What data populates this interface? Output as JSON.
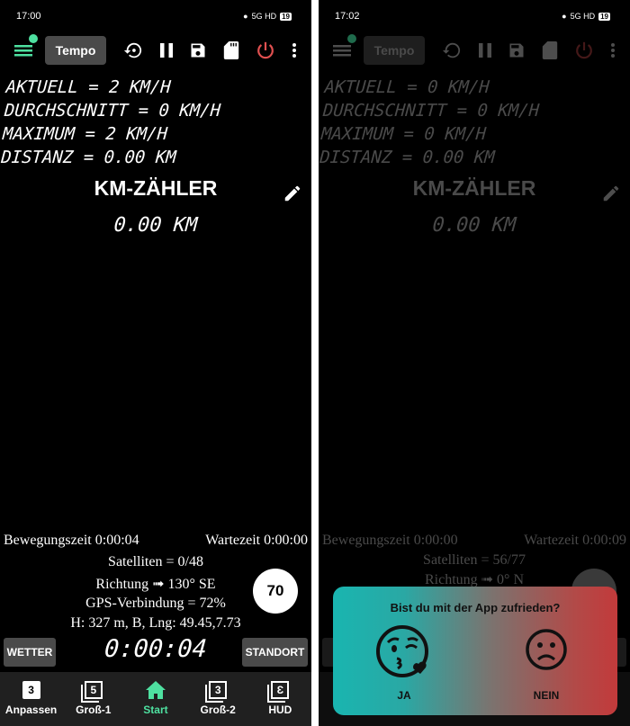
{
  "left": {
    "status": {
      "time": "17:00",
      "signal": "5G HD",
      "battery": "19"
    },
    "toolbar": {
      "tempo_label": "Tempo",
      "icons": [
        "menu-icon",
        "history-icon",
        "pause-icon",
        "save-icon",
        "sd-card-icon",
        "power-icon",
        "more-vert-icon"
      ],
      "accent": "#4ee0a0",
      "power_color": "#e05050"
    },
    "readouts": [
      "AKTUELL = 2 KM/H",
      "DURCHSCHNITT = 0 KM/H",
      "MAXIMUM = 2 KM/H",
      "DISTANZ = 0.00 KM"
    ],
    "km_title": "KM-ZÄHLER",
    "km_value": "0.00 KM",
    "moving_time": "Bewegungszeit 0:00:04",
    "wait_time": "Wartezeit 0:00:00",
    "satellites": "Satelliten = 0/48",
    "direction": "Richtung ➟ 130° SE",
    "gps": "GPS-Verbindung = 72%",
    "position": "H: 327 m, B, Lng: 49.45,7.73",
    "speed_limit": "70",
    "weather_btn": "WETTER",
    "location_btn": "STANDORT",
    "timer": "0:00:04",
    "nav": [
      {
        "label": "Anpassen",
        "badge": "3"
      },
      {
        "label": "Groß-1",
        "badge": "5"
      },
      {
        "label": "Start"
      },
      {
        "label": "Groß-2",
        "badge": "3"
      },
      {
        "label": "HUD",
        "badge": "Ɛ"
      }
    ]
  },
  "right": {
    "status": {
      "time": "17:02",
      "signal": "5G HD",
      "battery": "19"
    },
    "toolbar": {
      "tempo_label": "Tempo"
    },
    "readouts": [
      "AKTUELL = 0 KM/H",
      "DURCHSCHNITT = 0 KM/H",
      "MAXIMUM = 0 KM/H",
      "DISTANZ = 0.00 KM"
    ],
    "km_title": "KM-ZÄHLER",
    "km_value": "0.00 KM",
    "moving_time": "Bewegungszeit 0:00:00",
    "wait_time": "Wartezeit 0:00:09",
    "satellites": "Satelliten = 56/77",
    "direction": "Richtung ➟ 0° N",
    "dialog": {
      "question": "Bist du mit der App zufrieden?",
      "yes": "JA",
      "no": "NEIN",
      "gradient": [
        "#19b5b0",
        "#c23a3b"
      ]
    }
  }
}
